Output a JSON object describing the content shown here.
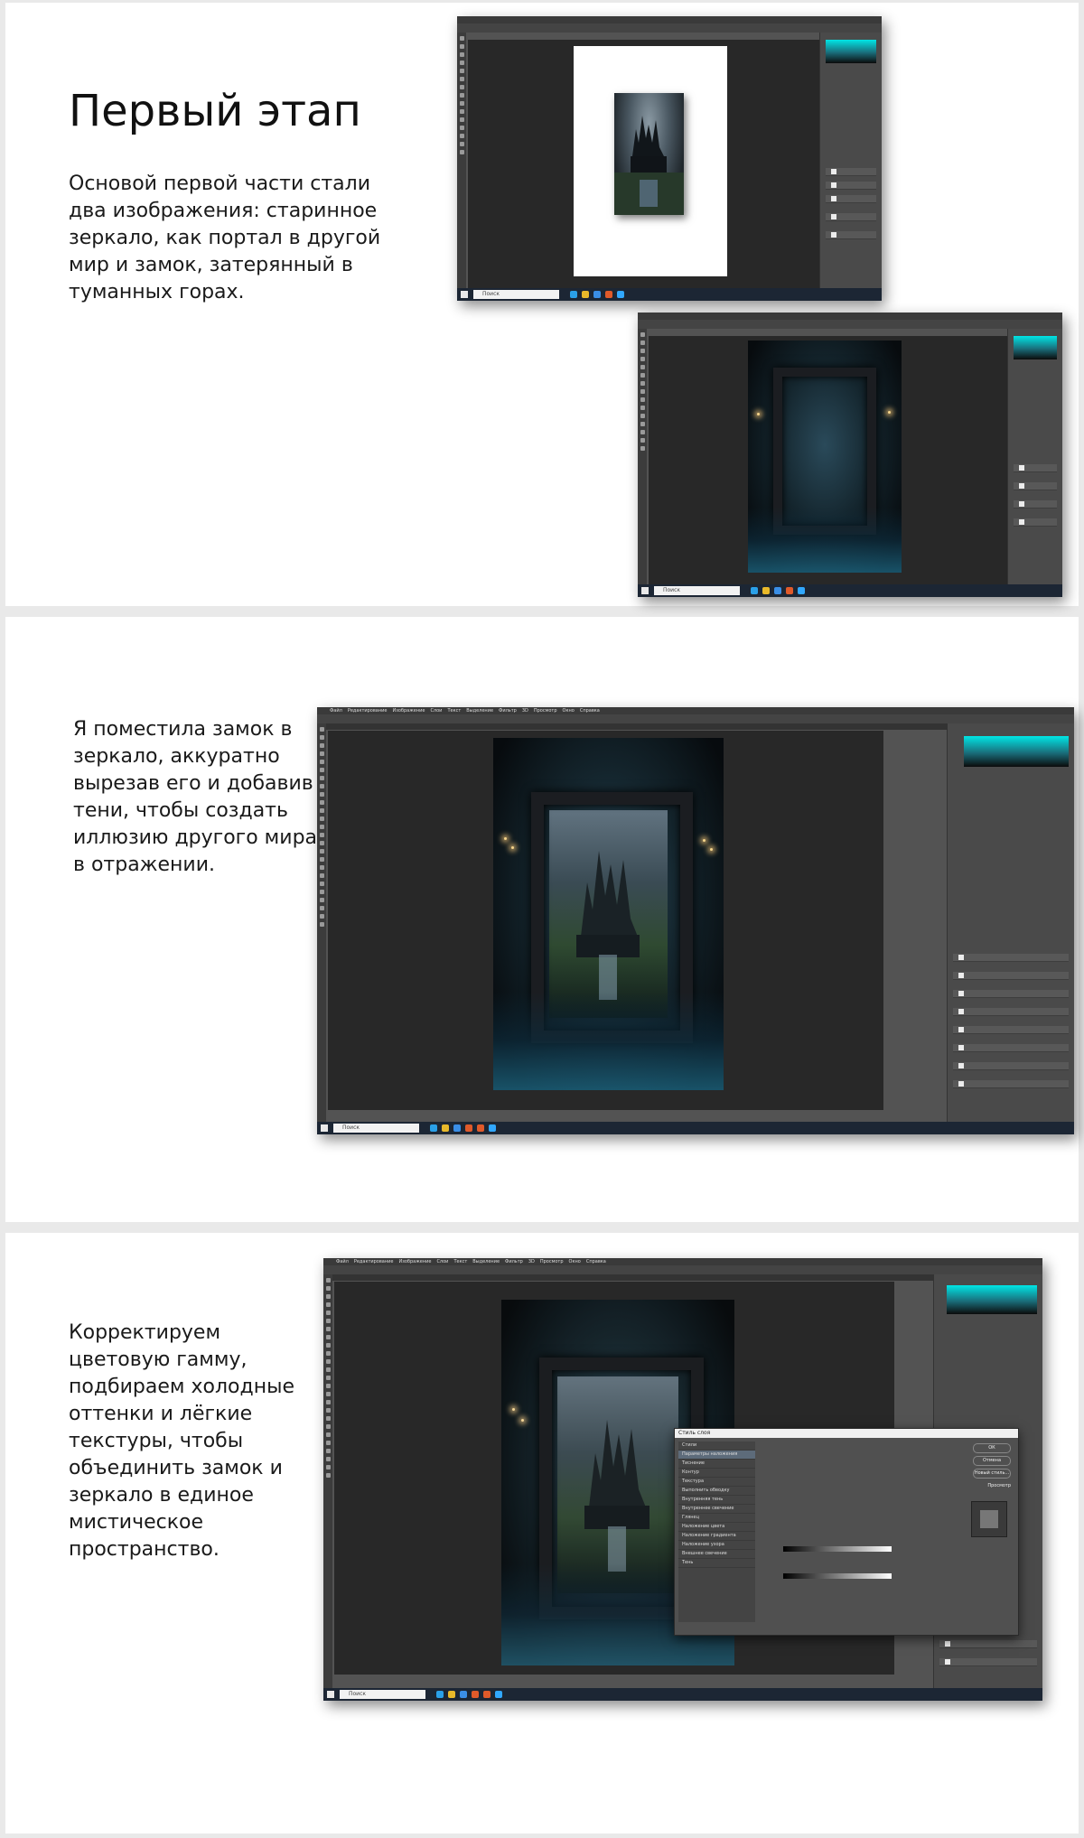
{
  "section1": {
    "title": "Первый этап",
    "paragraph_lines": [
      "Основой первой части стали",
      "два изображения: старинное",
      "зеркало, как портал в другой",
      "мир и замок, затерянный в",
      "туманных горах."
    ]
  },
  "section2": {
    "paragraph_lines": [
      "Я поместила замок в",
      "зеркало, аккуратно",
      "вырезав его и добавив",
      "тени, чтобы создать",
      "иллюзию другого мира",
      "в отражении."
    ]
  },
  "section3": {
    "paragraph_lines": [
      "Корректируем",
      "цветовую гамму,",
      "подбираем холодные",
      "оттенки и лёгкие",
      "текстуры, чтобы",
      "объединить замок и",
      "зеркало в единое",
      "мистическое",
      "пространство."
    ]
  },
  "screenshot_ui": {
    "menu": [
      "Файл",
      "Редактирование",
      "Изображение",
      "Слои",
      "Текст",
      "Выделение",
      "Фильтр",
      "3D",
      "Просмотр",
      "Окно",
      "Справка"
    ],
    "taskbar_search": "Поиск",
    "dialog_title": "Стиль слоя",
    "dialog_items": [
      "Стили",
      "Параметры наложения",
      "Тиснение",
      "Контур",
      "Текстура",
      "Выполнить обводку",
      "Внутренняя тень",
      "Внутреннее свечение",
      "Глянец",
      "Наложение цвета",
      "Наложение градиента",
      "Наложение узора",
      "Внешнее свечение",
      "Тень"
    ],
    "dialog_buttons": [
      "ОК",
      "Отмена",
      "Новый стиль...",
      "Просмотр"
    ]
  },
  "colors": {
    "accent_cyan": "#00e5e5",
    "ps_background": "#535353",
    "taskbar": "#1c2634"
  }
}
